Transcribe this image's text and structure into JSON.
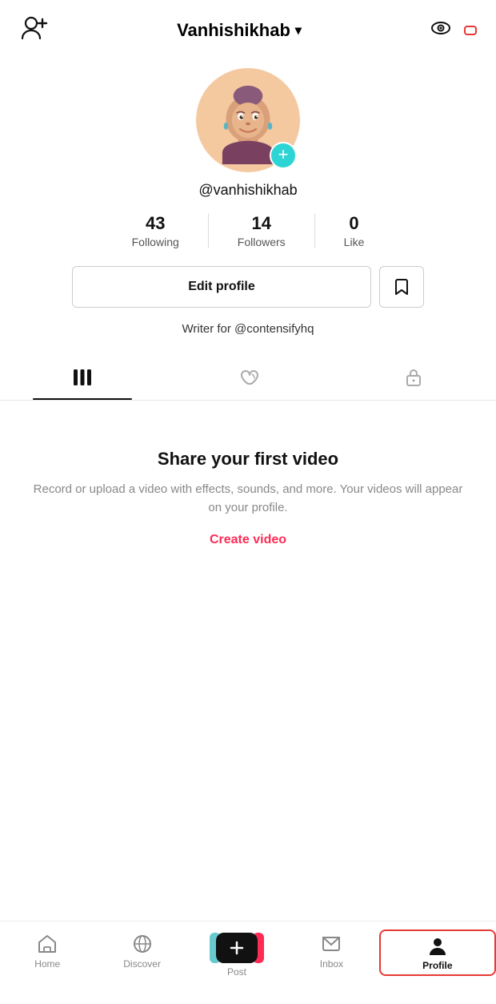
{
  "header": {
    "title": "Vanhishikhab",
    "title_arrow": "▾",
    "add_user_label": "add-user",
    "eye_label": "eye",
    "menu_label": "menu"
  },
  "profile": {
    "username": "@vanhishikhab",
    "stats": [
      {
        "number": "43",
        "label": "Following"
      },
      {
        "number": "14",
        "label": "Followers"
      },
      {
        "number": "0",
        "label": "Like"
      }
    ],
    "edit_button": "Edit profile",
    "bio": "Writer for @contensifyhq"
  },
  "tabs": [
    {
      "id": "videos",
      "active": true
    },
    {
      "id": "liked",
      "active": false
    },
    {
      "id": "private",
      "active": false
    }
  ],
  "empty_state": {
    "title": "Share your first video",
    "description": "Record or upload a video with effects, sounds, and more. Your videos will appear on your profile.",
    "cta": "Create video"
  },
  "bottom_nav": [
    {
      "id": "home",
      "label": "Home",
      "active": false
    },
    {
      "id": "discover",
      "label": "Discover",
      "active": false
    },
    {
      "id": "post",
      "label": "Post",
      "active": false
    },
    {
      "id": "inbox",
      "label": "Inbox",
      "active": false
    },
    {
      "id": "profile",
      "label": "Profile",
      "active": true
    }
  ]
}
